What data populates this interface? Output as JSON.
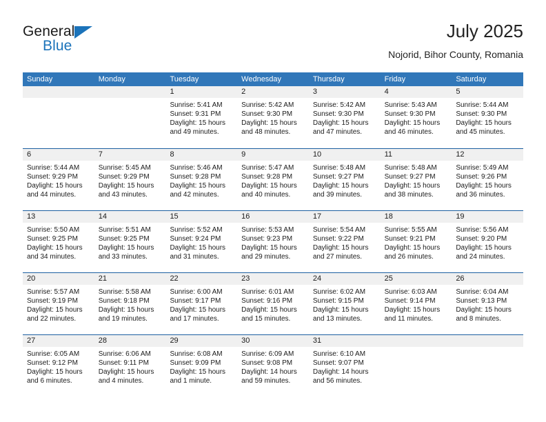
{
  "brand": {
    "name_top": "General",
    "name_bottom": "Blue"
  },
  "header": {
    "month_title": "July 2025",
    "location": "Nojorid, Bihor County, Romania"
  },
  "colors": {
    "header_blue": "#3177b9",
    "separator_blue": "#1b5fa0",
    "day_band_gray": "#f0f0f0",
    "brand_blue": "#1b73ba"
  },
  "weekdays": [
    "Sunday",
    "Monday",
    "Tuesday",
    "Wednesday",
    "Thursday",
    "Friday",
    "Saturday"
  ],
  "labels": {
    "sunrise_prefix": "Sunrise:",
    "sunset_prefix": "Sunset:",
    "daylight_prefix": "Daylight:"
  },
  "weeks": [
    [
      {
        "day": "",
        "empty": true
      },
      {
        "day": "",
        "empty": true
      },
      {
        "day": "1",
        "sunrise": "Sunrise: 5:41 AM",
        "sunset": "Sunset: 9:31 PM",
        "daylight_line1": "Daylight: 15 hours",
        "daylight_line2": "and 49 minutes."
      },
      {
        "day": "2",
        "sunrise": "Sunrise: 5:42 AM",
        "sunset": "Sunset: 9:30 PM",
        "daylight_line1": "Daylight: 15 hours",
        "daylight_line2": "and 48 minutes."
      },
      {
        "day": "3",
        "sunrise": "Sunrise: 5:42 AM",
        "sunset": "Sunset: 9:30 PM",
        "daylight_line1": "Daylight: 15 hours",
        "daylight_line2": "and 47 minutes."
      },
      {
        "day": "4",
        "sunrise": "Sunrise: 5:43 AM",
        "sunset": "Sunset: 9:30 PM",
        "daylight_line1": "Daylight: 15 hours",
        "daylight_line2": "and 46 minutes."
      },
      {
        "day": "5",
        "sunrise": "Sunrise: 5:44 AM",
        "sunset": "Sunset: 9:30 PM",
        "daylight_line1": "Daylight: 15 hours",
        "daylight_line2": "and 45 minutes."
      }
    ],
    [
      {
        "day": "6",
        "sunrise": "Sunrise: 5:44 AM",
        "sunset": "Sunset: 9:29 PM",
        "daylight_line1": "Daylight: 15 hours",
        "daylight_line2": "and 44 minutes."
      },
      {
        "day": "7",
        "sunrise": "Sunrise: 5:45 AM",
        "sunset": "Sunset: 9:29 PM",
        "daylight_line1": "Daylight: 15 hours",
        "daylight_line2": "and 43 minutes."
      },
      {
        "day": "8",
        "sunrise": "Sunrise: 5:46 AM",
        "sunset": "Sunset: 9:28 PM",
        "daylight_line1": "Daylight: 15 hours",
        "daylight_line2": "and 42 minutes."
      },
      {
        "day": "9",
        "sunrise": "Sunrise: 5:47 AM",
        "sunset": "Sunset: 9:28 PM",
        "daylight_line1": "Daylight: 15 hours",
        "daylight_line2": "and 40 minutes."
      },
      {
        "day": "10",
        "sunrise": "Sunrise: 5:48 AM",
        "sunset": "Sunset: 9:27 PM",
        "daylight_line1": "Daylight: 15 hours",
        "daylight_line2": "and 39 minutes."
      },
      {
        "day": "11",
        "sunrise": "Sunrise: 5:48 AM",
        "sunset": "Sunset: 9:27 PM",
        "daylight_line1": "Daylight: 15 hours",
        "daylight_line2": "and 38 minutes."
      },
      {
        "day": "12",
        "sunrise": "Sunrise: 5:49 AM",
        "sunset": "Sunset: 9:26 PM",
        "daylight_line1": "Daylight: 15 hours",
        "daylight_line2": "and 36 minutes."
      }
    ],
    [
      {
        "day": "13",
        "sunrise": "Sunrise: 5:50 AM",
        "sunset": "Sunset: 9:25 PM",
        "daylight_line1": "Daylight: 15 hours",
        "daylight_line2": "and 34 minutes."
      },
      {
        "day": "14",
        "sunrise": "Sunrise: 5:51 AM",
        "sunset": "Sunset: 9:25 PM",
        "daylight_line1": "Daylight: 15 hours",
        "daylight_line2": "and 33 minutes."
      },
      {
        "day": "15",
        "sunrise": "Sunrise: 5:52 AM",
        "sunset": "Sunset: 9:24 PM",
        "daylight_line1": "Daylight: 15 hours",
        "daylight_line2": "and 31 minutes."
      },
      {
        "day": "16",
        "sunrise": "Sunrise: 5:53 AM",
        "sunset": "Sunset: 9:23 PM",
        "daylight_line1": "Daylight: 15 hours",
        "daylight_line2": "and 29 minutes."
      },
      {
        "day": "17",
        "sunrise": "Sunrise: 5:54 AM",
        "sunset": "Sunset: 9:22 PM",
        "daylight_line1": "Daylight: 15 hours",
        "daylight_line2": "and 27 minutes."
      },
      {
        "day": "18",
        "sunrise": "Sunrise: 5:55 AM",
        "sunset": "Sunset: 9:21 PM",
        "daylight_line1": "Daylight: 15 hours",
        "daylight_line2": "and 26 minutes."
      },
      {
        "day": "19",
        "sunrise": "Sunrise: 5:56 AM",
        "sunset": "Sunset: 9:20 PM",
        "daylight_line1": "Daylight: 15 hours",
        "daylight_line2": "and 24 minutes."
      }
    ],
    [
      {
        "day": "20",
        "sunrise": "Sunrise: 5:57 AM",
        "sunset": "Sunset: 9:19 PM",
        "daylight_line1": "Daylight: 15 hours",
        "daylight_line2": "and 22 minutes."
      },
      {
        "day": "21",
        "sunrise": "Sunrise: 5:58 AM",
        "sunset": "Sunset: 9:18 PM",
        "daylight_line1": "Daylight: 15 hours",
        "daylight_line2": "and 19 minutes."
      },
      {
        "day": "22",
        "sunrise": "Sunrise: 6:00 AM",
        "sunset": "Sunset: 9:17 PM",
        "daylight_line1": "Daylight: 15 hours",
        "daylight_line2": "and 17 minutes."
      },
      {
        "day": "23",
        "sunrise": "Sunrise: 6:01 AM",
        "sunset": "Sunset: 9:16 PM",
        "daylight_line1": "Daylight: 15 hours",
        "daylight_line2": "and 15 minutes."
      },
      {
        "day": "24",
        "sunrise": "Sunrise: 6:02 AM",
        "sunset": "Sunset: 9:15 PM",
        "daylight_line1": "Daylight: 15 hours",
        "daylight_line2": "and 13 minutes."
      },
      {
        "day": "25",
        "sunrise": "Sunrise: 6:03 AM",
        "sunset": "Sunset: 9:14 PM",
        "daylight_line1": "Daylight: 15 hours",
        "daylight_line2": "and 11 minutes."
      },
      {
        "day": "26",
        "sunrise": "Sunrise: 6:04 AM",
        "sunset": "Sunset: 9:13 PM",
        "daylight_line1": "Daylight: 15 hours",
        "daylight_line2": "and 8 minutes."
      }
    ],
    [
      {
        "day": "27",
        "sunrise": "Sunrise: 6:05 AM",
        "sunset": "Sunset: 9:12 PM",
        "daylight_line1": "Daylight: 15 hours",
        "daylight_line2": "and 6 minutes."
      },
      {
        "day": "28",
        "sunrise": "Sunrise: 6:06 AM",
        "sunset": "Sunset: 9:11 PM",
        "daylight_line1": "Daylight: 15 hours",
        "daylight_line2": "and 4 minutes."
      },
      {
        "day": "29",
        "sunrise": "Sunrise: 6:08 AM",
        "sunset": "Sunset: 9:09 PM",
        "daylight_line1": "Daylight: 15 hours",
        "daylight_line2": "and 1 minute."
      },
      {
        "day": "30",
        "sunrise": "Sunrise: 6:09 AM",
        "sunset": "Sunset: 9:08 PM",
        "daylight_line1": "Daylight: 14 hours",
        "daylight_line2": "and 59 minutes."
      },
      {
        "day": "31",
        "sunrise": "Sunrise: 6:10 AM",
        "sunset": "Sunset: 9:07 PM",
        "daylight_line1": "Daylight: 14 hours",
        "daylight_line2": "and 56 minutes."
      },
      {
        "day": "",
        "empty": true
      },
      {
        "day": "",
        "empty": true
      }
    ]
  ]
}
